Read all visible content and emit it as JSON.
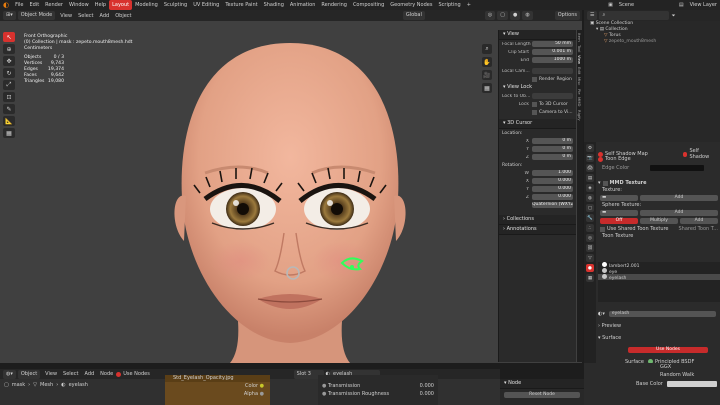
{
  "menu": {
    "items": [
      "File",
      "Edit",
      "Render",
      "Window",
      "Help"
    ],
    "workspaces": [
      "Layout",
      "Modeling",
      "Sculpting",
      "UV Editing",
      "Texture Paint",
      "Shading",
      "Animation",
      "Rendering",
      "Compositing",
      "Geometry Nodes",
      "Scripting"
    ],
    "active_workspace": "Layout",
    "plus": "+",
    "scene_label": "Scene",
    "view_layer_label": "View Layer"
  },
  "viewport_header": {
    "mode": "Object Mode",
    "view": "View",
    "select": "Select",
    "add": "Add",
    "object": "Object",
    "orientation": "Global",
    "options": "Options"
  },
  "stats": {
    "view": "Front Orthographic",
    "collection": "(0) Collection | mask : zepeto.mouth8mesh.hdt",
    "units": "Centimeters",
    "rows": [
      {
        "label": "Objects",
        "value": "0 / 3"
      },
      {
        "label": "Vertices",
        "value": "9,743"
      },
      {
        "label": "Edges",
        "value": "19,374"
      },
      {
        "label": "Faces",
        "value": "9,642"
      },
      {
        "label": "Triangles",
        "value": "19,080"
      }
    ]
  },
  "npanel": {
    "view_title": "View",
    "focal_label": "Focal Length",
    "focal_value": "50 mm",
    "clip_start_label": "Clip Start",
    "clip_start_value": "0.001 m",
    "end_label": "End",
    "end_value": "1000 m",
    "local_camera_label": "Local Cam...",
    "render_region": "Render Region",
    "view_lock": "View Lock",
    "lock_to_object": "Lock to Ob...",
    "lock_label": "Lock",
    "to_3d_cursor": "To 3D Cursor",
    "camera_to_view": "Camera to Vi...",
    "cursor_title": "3D Cursor",
    "location": "Location:",
    "x": "X",
    "y": "Y",
    "z": "Z",
    "loc_x": "0 m",
    "loc_y": "0 m",
    "loc_z": "0 m",
    "rotation": "Rotation:",
    "w": "W",
    "rot_w": "1.000",
    "rot_x": "0.000",
    "rot_y": "0.000",
    "rot_z": "0.000",
    "rotation_mode": "Quaternion (WXYZ)",
    "collections": "Collections",
    "annotations": "Annotations",
    "tabs": [
      "Item",
      "Tool",
      "View",
      "Edit",
      "Misc",
      "Pie",
      "MMD",
      "Rigify"
    ]
  },
  "outliner": {
    "header": "Scene Collection",
    "items": [
      {
        "label": "Collection",
        "indent": 1
      },
      {
        "label": "Torus",
        "indent": 2
      },
      {
        "label": "zepeto_mouth8mesh",
        "indent": 2
      }
    ]
  },
  "properties": {
    "self_shadow_map": "Self Shadow Map",
    "self_shadow": "Self Shadow",
    "toon_edge": "Toon Edge",
    "edge_color": "Edge Color",
    "mmd_texture": "MMD Texture",
    "texture_label": "Texture:",
    "add": "Add",
    "sphere_texture_label": "Sphere Texture:",
    "off": "Off",
    "multiply": "Multiply",
    "add2": "Add",
    "use_shared_toon": "Use Shared Toon Texture",
    "shared_toon_t": "Shared Toon T...",
    "toon_texture": "Toon Texture",
    "materials": [
      {
        "label": "lambert2.001",
        "color": "#ffffff"
      },
      {
        "label": "eye",
        "color": "#c8c8c8"
      },
      {
        "label": "eyelash",
        "color": "#c8c8c8"
      }
    ],
    "material_slot": "eyelash",
    "preview": "Preview",
    "surface": "Surface",
    "use_nodes": "Use Nodes",
    "surface_label": "Surface",
    "surface_value": "Principled BSDF",
    "ggx": "GGX",
    "random_walk": "Random Walk",
    "base_color": "Base Color"
  },
  "node_editor": {
    "object": "Object",
    "view": "View",
    "select": "Select",
    "add": "Add",
    "node": "Node",
    "use_nodes": "Use Nodes",
    "slot": "Slot 3",
    "material": "eyelash",
    "breadcrumb_mask": "mask",
    "breadcrumb_mesh": "Mesh",
    "breadcrumb_mat": "eyelash",
    "image_node_name": "Std_Eyelash_Opacity.jpg",
    "color_socket": "Color",
    "alpha_socket": "Alpha",
    "transmission": "Transmission",
    "transmission_value": "0.000",
    "transmission_roughness": "Transmission Roughness",
    "transmission_roughness_value": "0.000",
    "node_panel_title": "Node",
    "reset_node": "Reset Node"
  },
  "colors": {
    "accent": "#d8322e",
    "viewport_bg": "#404040",
    "skin": "#e8a98f",
    "glow": "#31ff5a"
  }
}
